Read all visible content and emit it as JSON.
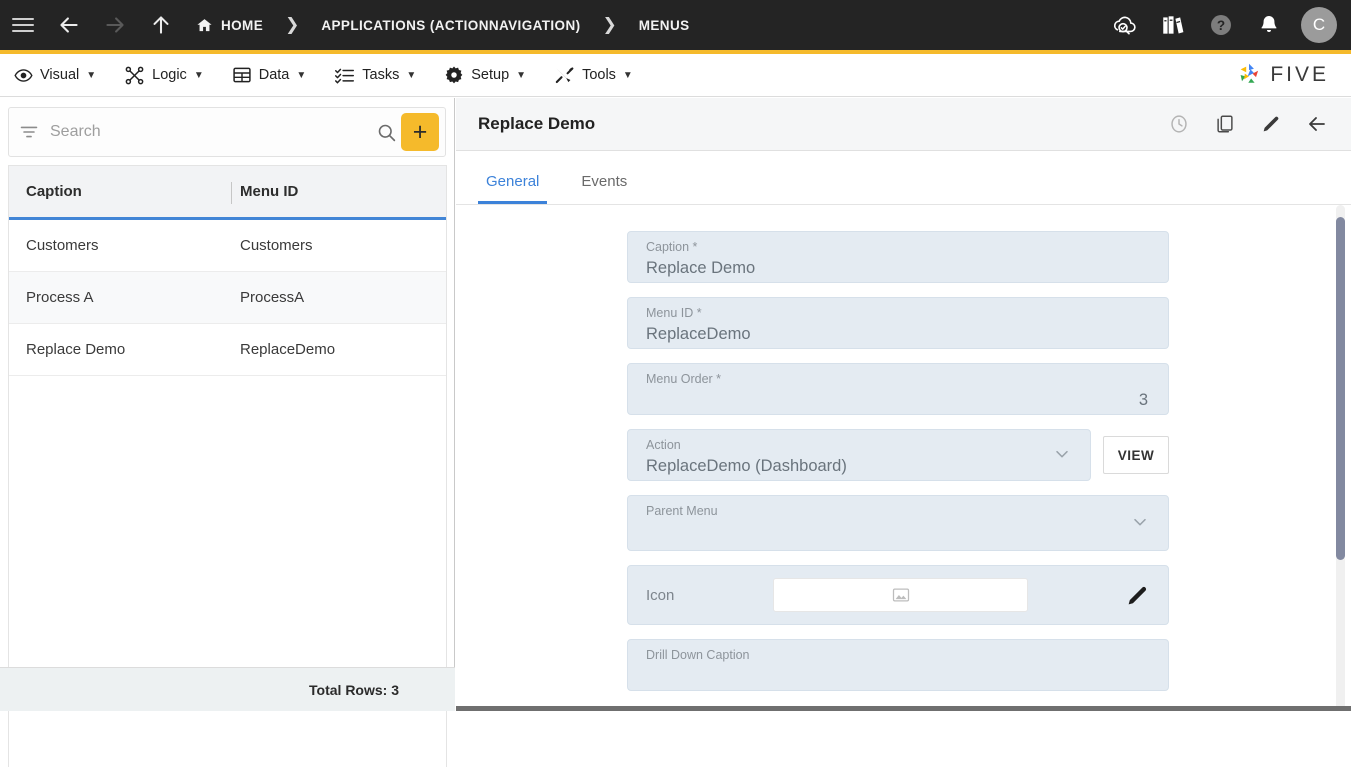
{
  "topbar": {
    "menu_icon": "hamburger-icon",
    "back_label": "←",
    "forward_label": "→",
    "up_label": "↑",
    "home_icon": "⌂",
    "breadcrumbs": [
      {
        "label": "HOME",
        "icon": "home-icon"
      },
      {
        "label": "APPLICATIONS (ACTIONNAVIGATION)",
        "icon": ""
      },
      {
        "label": "MENUS",
        "icon": ""
      }
    ],
    "separator": "❯",
    "right_icons": [
      "cloud-check-icon",
      "books-icon",
      "help-icon",
      "bell-icon"
    ],
    "avatar_initial": "C",
    "accent_color": "#f5ba2b",
    "background_color": "#242424"
  },
  "menubar": {
    "items": [
      {
        "label": "Visual",
        "icon": "eye-icon",
        "caret": "▼"
      },
      {
        "label": "Logic",
        "icon": "logic-nodes-icon",
        "caret": "▼"
      },
      {
        "label": "Data",
        "icon": "table-grid-icon",
        "caret": "▼"
      },
      {
        "label": "Tasks",
        "icon": "checklist-icon",
        "caret": "▼"
      },
      {
        "label": "Setup",
        "icon": "gear-icon",
        "caret": "▼"
      },
      {
        "label": "Tools",
        "icon": "tools-icon",
        "caret": "▼"
      }
    ],
    "brand": "FIVE"
  },
  "left_panel": {
    "search": {
      "placeholder": "Search",
      "value": "",
      "filter_icon": "filter-icon",
      "search_icon": "search-icon"
    },
    "add_button_label": "+",
    "add_button_color": "#f5ba2b",
    "grid": {
      "columns": [
        "Caption",
        "Menu ID"
      ],
      "header_underline_color": "#4285d6",
      "rows": [
        {
          "caption": "Customers",
          "menu_id": "Customers"
        },
        {
          "caption": "Process A",
          "menu_id": "ProcessA"
        },
        {
          "caption": "Replace Demo",
          "menu_id": "ReplaceDemo"
        }
      ]
    },
    "footer": {
      "total_rows_label": "Total Rows: 3"
    }
  },
  "right_panel": {
    "title": "Replace Demo",
    "actions": [
      "history-clock-icon",
      "copy-icon",
      "edit-pencil-icon",
      "back-arrow-icon"
    ],
    "tabs": [
      {
        "label": "General",
        "active": true
      },
      {
        "label": "Events",
        "active": false
      }
    ],
    "active_tab_color": "#3c82d9",
    "form": {
      "caption": {
        "label": "Caption *",
        "value": "Replace Demo"
      },
      "menu_id": {
        "label": "Menu ID *",
        "value": "ReplaceDemo"
      },
      "menu_order": {
        "label": "Menu Order *",
        "value": "3"
      },
      "action": {
        "label": "Action",
        "value": "ReplaceDemo (Dashboard)",
        "chevron": "chevron-down-icon",
        "view_button": "VIEW"
      },
      "parent_menu": {
        "label": "Parent Menu",
        "value": "",
        "chevron": "chevron-down-icon"
      },
      "icon_field": {
        "label": "Icon",
        "placeholder_icon": "image-placeholder-icon",
        "edit_icon": "edit-pencil-icon"
      },
      "drill_down_caption": {
        "label": "Drill Down Caption",
        "value": ""
      }
    },
    "field_background": "#e4ebf2"
  }
}
